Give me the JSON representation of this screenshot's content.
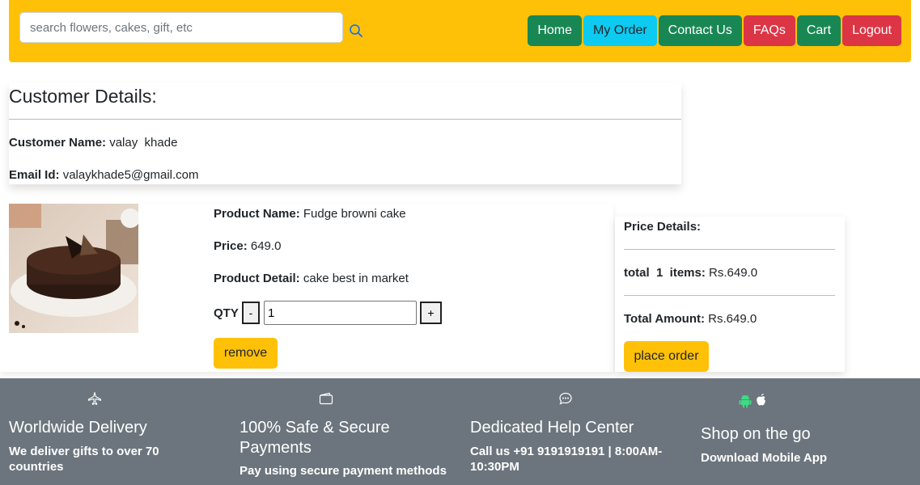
{
  "header": {
    "search_placeholder": "search flowers, cakes, gift, etc",
    "nav": {
      "home": "Home",
      "my_order": "My Order",
      "contact_us": "Contact Us",
      "faqs": "FAQs",
      "cart": "Cart",
      "logout": "Logout"
    }
  },
  "customer": {
    "title": "Customer Details:",
    "name_label": "Customer Name:",
    "name_value": "valay  khade",
    "email_label": "Email Id:",
    "email_value": "valaykhade5@gmail.com"
  },
  "product": {
    "name_label": "Product Name:",
    "name_value": "Fudge browni cake",
    "price_label": "Price:",
    "price_value": "649.0",
    "detail_label": "Product Detail:",
    "detail_value": "cake best in market",
    "qty_label": "QTY",
    "qty_minus": "-",
    "qty_plus": "+",
    "qty_value": "1",
    "remove_label": "remove"
  },
  "price_details": {
    "title": "Price Details:",
    "items_label": "total  1  items:",
    "items_value": "Rs.649.0",
    "total_label": "Total Amount:",
    "total_value": "Rs.649.0",
    "place_order_label": "place order"
  },
  "footer": {
    "features": [
      {
        "icon": "plane-icon",
        "title": "Worldwide Delivery",
        "subtitle": "We deliver gifts to over 70 countries"
      },
      {
        "icon": "wallet-icon",
        "title": "100% Safe & Secure Payments",
        "subtitle": "Pay using secure payment methods"
      },
      {
        "icon": "chat-icon",
        "title": "Dedicated Help Center",
        "subtitle": "Call us +91 9191919191 | 8:00AM-10:30PM"
      },
      {
        "icon": "android-apple-icon",
        "title": "Shop on the go",
        "subtitle": "Download Mobile App"
      }
    ]
  },
  "colors": {
    "header_bg": "#ffc107",
    "green": "#198754",
    "cyan": "#0dcaf0",
    "red": "#dc3545",
    "footer_bg": "#6c757d",
    "android_green": "#3ddc84"
  }
}
